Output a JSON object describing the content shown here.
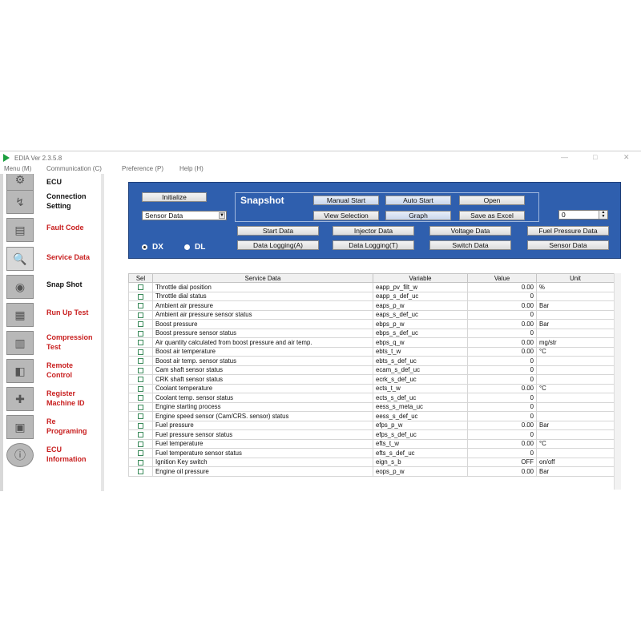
{
  "window": {
    "title": "EDIA Ver 2.3.5.8",
    "controls": {
      "minimize": "—",
      "maximize": "□",
      "close": "✕"
    }
  },
  "menu": [
    "Menu (M)",
    "Communication (C)",
    "Preference (P)",
    "Help (H)"
  ],
  "sidebar": [
    {
      "label": "ECU",
      "color": "black",
      "icon": "ecu-icon"
    },
    {
      "label": "Connection Setting",
      "color": "black",
      "icon": "connection-icon"
    },
    {
      "label": "Fault Code",
      "color": "red",
      "icon": "fault-code-icon"
    },
    {
      "label": "Service Data",
      "color": "red",
      "icon": "magnifier-icon"
    },
    {
      "label": "Snap Shot",
      "color": "black",
      "icon": "camera-icon"
    },
    {
      "label": "Run Up Test",
      "color": "red",
      "icon": "run-up-icon"
    },
    {
      "label": "Compression Test",
      "color": "red",
      "icon": "compression-icon"
    },
    {
      "label": "Remote Control",
      "color": "red",
      "icon": "remote-icon"
    },
    {
      "label": "Register Machine ID",
      "color": "red",
      "icon": "register-icon"
    },
    {
      "label": "Re Programing",
      "color": "red",
      "icon": "reprogram-icon"
    },
    {
      "label": "ECU Information",
      "color": "red",
      "icon": "info-icon"
    }
  ],
  "panel": {
    "initialize": "Initialize",
    "combo_value": "Sensor Data",
    "snapshot_title": "Snapshot",
    "manual_start": "Manual Start",
    "auto_start": "Auto Start",
    "open": "Open",
    "view_selection": "View Selection",
    "graph": "Graph",
    "save_excel": "Save as Excel",
    "spin_value": "0",
    "start_data": "Start Data",
    "injector_data": "Injector Data",
    "voltage_data": "Voltage Data",
    "fuel_pressure_data": "Fuel Pressure Data",
    "logging_a": "Data Logging(A)",
    "logging_t": "Data Logging(T)",
    "switch_data": "Switch Data",
    "sensor_data": "Sensor Data",
    "radio_dx": "DX",
    "radio_dl": "DL"
  },
  "table": {
    "headers": [
      "Sel",
      "Service Data",
      "Variable",
      "Value",
      "Unit"
    ],
    "rows": [
      [
        "Throttle dial position",
        "eapp_pv_filt_w",
        "0.00",
        "%"
      ],
      [
        "Throttle dial status",
        "eapp_s_def_uc",
        "0",
        ""
      ],
      [
        "Ambient air pressure",
        "eaps_p_w",
        "0.00",
        "Bar"
      ],
      [
        "Ambient air pressure sensor status",
        "eaps_s_def_uc",
        "0",
        ""
      ],
      [
        "Boost pressure",
        "ebps_p_w",
        "0.00",
        "Bar"
      ],
      [
        "Boost pressure sensor status",
        "ebps_s_def_uc",
        "0",
        ""
      ],
      [
        "Air quantity calculated from boost pressure and air temp.",
        "ebps_q_w",
        "0.00",
        "mg/str"
      ],
      [
        "Boost air temperature",
        "ebts_t_w",
        "0.00",
        "°C"
      ],
      [
        "Boost air temp. sensor status",
        "ebts_s_def_uc",
        "0",
        ""
      ],
      [
        "Cam shaft sensor status",
        "ecam_s_def_uc",
        "0",
        ""
      ],
      [
        "CRK shaft sensor status",
        "ecrk_s_def_uc",
        "0",
        ""
      ],
      [
        "Coolant temperature",
        "ects_t_w",
        "0.00",
        "°C"
      ],
      [
        "Coolant temp. sensor status",
        "ects_s_def_uc",
        "0",
        ""
      ],
      [
        "Engine starting process",
        "eess_s_meta_uc",
        "0",
        ""
      ],
      [
        "Engine speed sensor (Cam/CRS. sensor) status",
        "eess_s_def_uc",
        "0",
        ""
      ],
      [
        "Fuel pressure",
        "efps_p_w",
        "0.00",
        "Bar"
      ],
      [
        "Fuel pressure sensor status",
        "efps_s_def_uc",
        "0",
        ""
      ],
      [
        "Fuel temperature",
        "efts_t_w",
        "0.00",
        "°C"
      ],
      [
        "Fuel temperature sensor status",
        "efts_s_def_uc",
        "0",
        ""
      ],
      [
        "Ignition Key switch",
        "eign_s_b",
        "OFF",
        "on/off"
      ],
      [
        "Engine oil pressure",
        "eops_p_w",
        "0.00",
        "Bar"
      ]
    ]
  }
}
